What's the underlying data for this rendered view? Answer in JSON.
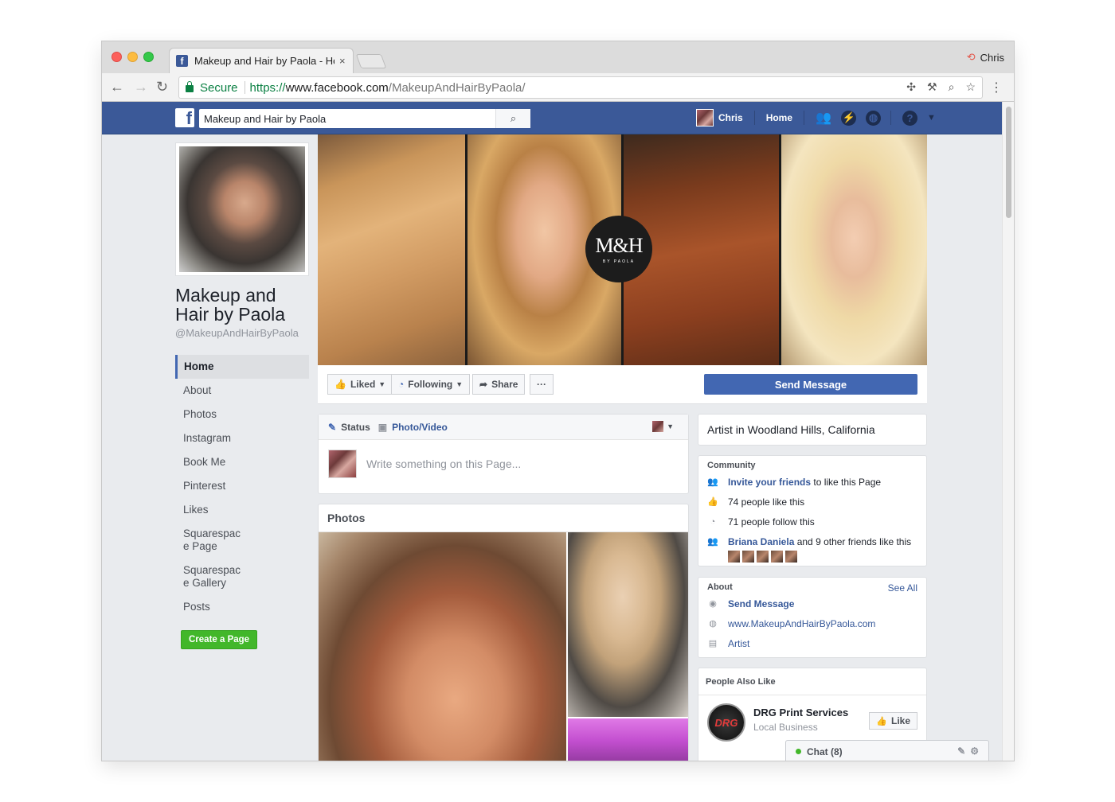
{
  "browser": {
    "tab_title": "Makeup and Hair by Paola - Ho",
    "tab_close": "×",
    "profile_name": "Chris",
    "secure_label": "Secure",
    "url_proto": "https://",
    "url_host": "www.facebook.com",
    "url_path": "/MakeupAndHairByPaola/"
  },
  "fb": {
    "search_value": "Makeup and Hair by Paola",
    "nav_user": "Chris",
    "nav_home": "Home"
  },
  "page": {
    "name": "Makeup and Hair by Paola",
    "handle": "@MakeupAndHairByPaola",
    "create_page": "Create a Page",
    "cover_logo": "M&H",
    "cover_logo_sub": "BY PAOLA"
  },
  "sidenav": {
    "items": [
      {
        "label": "Home"
      },
      {
        "label": "About"
      },
      {
        "label": "Photos"
      },
      {
        "label": "Instagram"
      },
      {
        "label": "Book Me"
      },
      {
        "label": "Pinterest"
      },
      {
        "label": "Likes"
      },
      {
        "label": "Squarespac\ne Page"
      },
      {
        "label": "Squarespac\ne Gallery"
      },
      {
        "label": "Posts"
      }
    ]
  },
  "actions": {
    "liked": "Liked",
    "following": "Following",
    "share": "Share",
    "more": "···",
    "send_message": "Send Message"
  },
  "composer": {
    "status": "Status",
    "photo_video": "Photo/Video",
    "placeholder": "Write something on this Page..."
  },
  "photos": {
    "title": "Photos"
  },
  "right": {
    "artist_location": "Artist in Woodland Hills, California",
    "community": {
      "heading": "Community",
      "invite_link": "Invite your friends",
      "invite_rest": " to like this Page",
      "likes": "74 people like this",
      "follows": "71 people follow this",
      "friend_link": "Briana Daniela",
      "friend_rest": " and 9 other friends like this"
    },
    "about": {
      "heading": "About",
      "see_all": "See All",
      "send_message": "Send Message",
      "website": "www.MakeupAndHairByPaola.com",
      "category": "Artist"
    },
    "also_like": {
      "heading": "People Also Like",
      "logo_text": "DRG",
      "name": "DRG Print Services",
      "category": "Local Business",
      "like": "Like"
    }
  },
  "chat": {
    "label": "Chat (8)"
  }
}
